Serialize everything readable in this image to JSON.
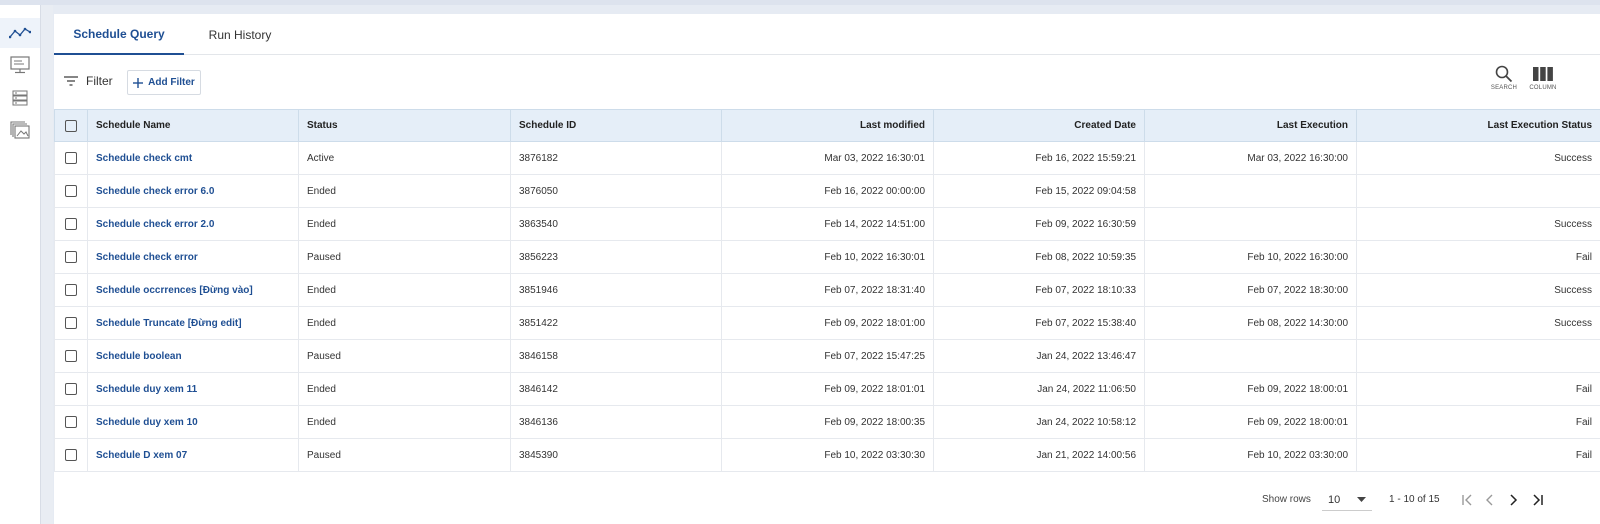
{
  "tabs": [
    {
      "label": "Schedule Query",
      "active": true
    },
    {
      "label": "Run History",
      "active": false
    }
  ],
  "toolbar": {
    "filter_label": "Filter",
    "add_filter_label": "Add Filter",
    "search_caption": "SEARCH",
    "column_caption": "COLUMN"
  },
  "table": {
    "headers": [
      "Schedule Name",
      "Status",
      "Schedule ID",
      "Last modified",
      "Created Date",
      "Last Execution",
      "Last Execution Status"
    ],
    "rows": [
      [
        "Schedule check cmt",
        "Active",
        "3876182",
        "Mar 03, 2022 16:30:01",
        "Feb 16, 2022 15:59:21",
        "Mar 03, 2022 16:30:00",
        "Success"
      ],
      [
        "Schedule check error 6.0",
        "Ended",
        "3876050",
        "Feb 16, 2022 00:00:00",
        "Feb 15, 2022 09:04:58",
        "",
        ""
      ],
      [
        "Schedule check error 2.0",
        "Ended",
        "3863540",
        "Feb 14, 2022 14:51:00",
        "Feb 09, 2022 16:30:59",
        "",
        "Success"
      ],
      [
        "Schedule check error",
        "Paused",
        "3856223",
        "Feb 10, 2022 16:30:01",
        "Feb 08, 2022 10:59:35",
        "Feb 10, 2022 16:30:00",
        "Fail"
      ],
      [
        "Schedule occrrences [Đừng vào]",
        "Ended",
        "3851946",
        "Feb 07, 2022 18:31:40",
        "Feb 07, 2022 18:10:33",
        "Feb 07, 2022 18:30:00",
        "Success"
      ],
      [
        "Schedule Truncate [Đừng edit]",
        "Ended",
        "3851422",
        "Feb 09, 2022 18:01:00",
        "Feb 07, 2022 15:38:40",
        "Feb 08, 2022 14:30:00",
        "Success"
      ],
      [
        "Schedule boolean",
        "Paused",
        "3846158",
        "Feb 07, 2022 15:47:25",
        "Jan 24, 2022 13:46:47",
        "",
        ""
      ],
      [
        "Schedule duy xem 11",
        "Ended",
        "3846142",
        "Feb 09, 2022 18:01:01",
        "Jan 24, 2022 11:06:50",
        "Feb 09, 2022 18:00:01",
        "Fail"
      ],
      [
        "Schedule duy xem 10",
        "Ended",
        "3846136",
        "Feb 09, 2022 18:00:35",
        "Jan 24, 2022 10:58:12",
        "Feb 09, 2022 18:00:01",
        "Fail"
      ],
      [
        "Schedule D xem 07",
        "Paused",
        "3845390",
        "Feb 10, 2022 03:30:30",
        "Jan 21, 2022 14:00:56",
        "Feb 10, 2022 03:30:00",
        "Fail"
      ]
    ]
  },
  "pagination": {
    "show_rows_label": "Show rows",
    "rows_per_page": "10",
    "range_text": "1 - 10 of 15"
  },
  "colors": {
    "accent": "#1f4f93",
    "header_bg": "#e5eef8"
  },
  "icons": {
    "rail": [
      "line-chart-icon",
      "monitor-icon",
      "server-list-icon",
      "gallery-icon"
    ],
    "toolbar": [
      "filter-icon",
      "plus-icon",
      "search-icon",
      "column-icon"
    ],
    "pager": [
      "first-page-icon",
      "prev-page-icon",
      "next-page-icon",
      "last-page-icon"
    ]
  }
}
